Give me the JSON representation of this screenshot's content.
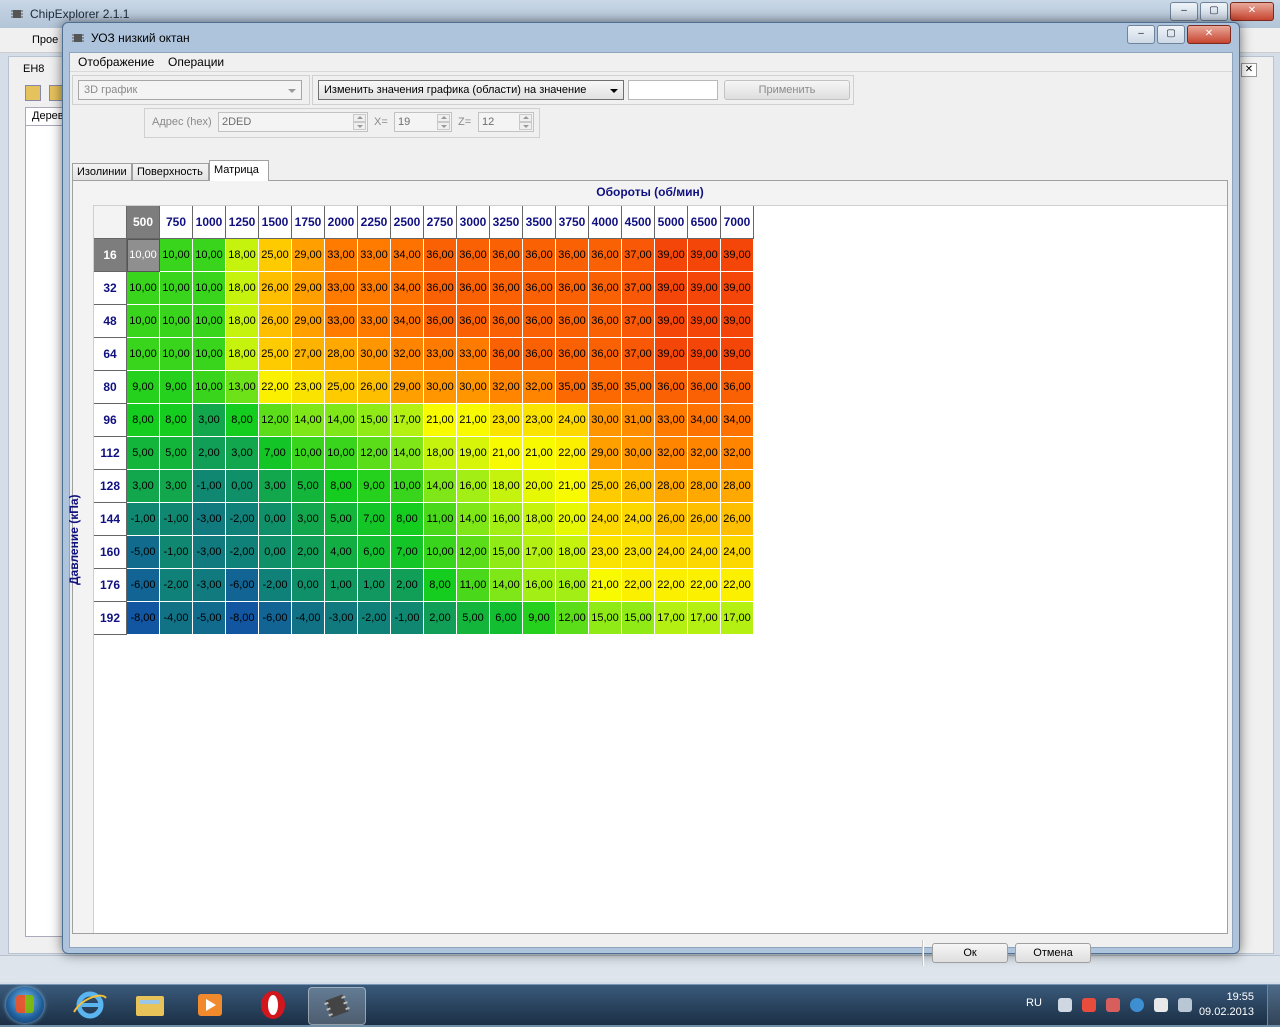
{
  "app": {
    "title": "ChipExplorer 2.1.1",
    "menu_first": "Прое",
    "doc_tab": "EH8",
    "tree_tab": "Дерево"
  },
  "dialog": {
    "title": "УОЗ низкий октан",
    "menu": [
      "Отображение",
      "Операции"
    ],
    "view_combo": "3D график",
    "operation_combo": "Изменить значения графика (области) на значение",
    "value_input": "",
    "apply_button": "Применить",
    "address_label": "Адрес (hex)",
    "address_value": "2DED",
    "x_label": "X=",
    "x_value": "19",
    "z_label": "Z=",
    "z_value": "12",
    "tabs": [
      {
        "label": "Изолинии",
        "active": false
      },
      {
        "label": "Поверхность",
        "active": false
      },
      {
        "label": "Матрица",
        "active": true
      }
    ],
    "ok_button": "Ок",
    "cancel_button": "Отмена"
  },
  "matrix": {
    "x_axis_label": "Обороты (об/мин)",
    "y_axis_label": "Давление (кПа)",
    "rpm": [
      500,
      750,
      1000,
      1250,
      1500,
      1750,
      2000,
      2250,
      2500,
      2750,
      3000,
      3250,
      3500,
      3750,
      4000,
      4500,
      5000,
      6500,
      7000
    ],
    "pressure": [
      16,
      32,
      48,
      64,
      80,
      96,
      112,
      128,
      144,
      160,
      176,
      192
    ],
    "selected": {
      "row": 0,
      "col": 0
    },
    "values": [
      [
        10,
        10,
        10,
        18,
        25,
        29,
        33,
        33,
        34,
        36,
        36,
        36,
        36,
        36,
        36,
        37,
        39,
        39,
        39
      ],
      [
        10,
        10,
        10,
        18,
        26,
        29,
        33,
        33,
        34,
        36,
        36,
        36,
        36,
        36,
        36,
        37,
        39,
        39,
        39
      ],
      [
        10,
        10,
        10,
        18,
        26,
        29,
        33,
        33,
        34,
        36,
        36,
        36,
        36,
        36,
        36,
        37,
        39,
        39,
        39
      ],
      [
        10,
        10,
        10,
        18,
        25,
        27,
        28,
        30,
        32,
        33,
        33,
        36,
        36,
        36,
        36,
        37,
        39,
        39,
        39
      ],
      [
        9,
        9,
        10,
        13,
        22,
        23,
        25,
        26,
        29,
        30,
        30,
        32,
        32,
        35,
        35,
        35,
        36,
        36,
        36
      ],
      [
        8,
        8,
        3,
        8,
        12,
        14,
        14,
        15,
        17,
        21,
        21,
        23,
        23,
        24,
        30,
        31,
        33,
        34,
        34
      ],
      [
        5,
        5,
        2,
        3,
        7,
        10,
        10,
        12,
        14,
        18,
        19,
        21,
        21,
        22,
        29,
        30,
        32,
        32,
        32
      ],
      [
        3,
        3,
        -1,
        0,
        3,
        5,
        8,
        9,
        10,
        14,
        16,
        18,
        20,
        21,
        25,
        26,
        28,
        28,
        28
      ],
      [
        -1,
        -1,
        -3,
        -2,
        0,
        3,
        5,
        7,
        8,
        11,
        14,
        16,
        18,
        20,
        24,
        24,
        26,
        26,
        26
      ],
      [
        -5,
        -1,
        -3,
        -2,
        0,
        2,
        4,
        6,
        7,
        10,
        12,
        15,
        17,
        18,
        23,
        23,
        24,
        24,
        24
      ],
      [
        -6,
        -2,
        -3,
        -6,
        -2,
        0,
        1,
        1,
        2,
        8,
        11,
        14,
        16,
        16,
        21,
        22,
        22,
        22,
        22
      ],
      [
        -8,
        -4,
        -5,
        -8,
        -6,
        -4,
        -3,
        -2,
        -1,
        2,
        5,
        6,
        9,
        12,
        15,
        15,
        17,
        17,
        17
      ]
    ]
  },
  "taskbar": {
    "lang": "RU",
    "time": "19:55",
    "date": "09.02.2013"
  }
}
